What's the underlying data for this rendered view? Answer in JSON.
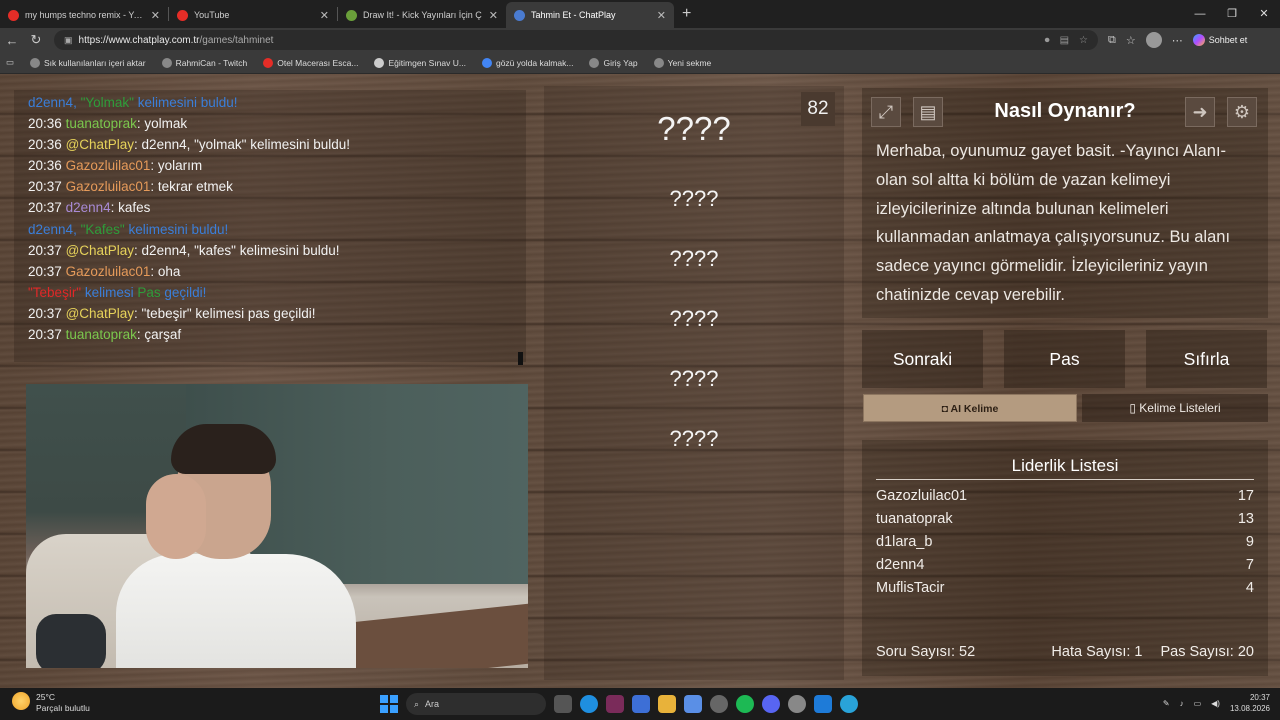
{
  "browser": {
    "tabs": [
      {
        "title": "my humps techno remix - YouTub",
        "favicon_color": "#e52d27",
        "active": false
      },
      {
        "title": "YouTube",
        "favicon_color": "#e52d27",
        "active": false
      },
      {
        "title": "Draw It! - Kick Yayınları İçin Ç",
        "favicon_color": "#6a9f3a",
        "active": false
      },
      {
        "title": "Tahmin Et - ChatPlay",
        "favicon_color": "#4a7bd0",
        "active": true
      }
    ],
    "url_host": "https://www.chatplay.com.tr",
    "url_path": "/games/tahminet",
    "copilot_label": "Sohbet et",
    "bookmarks": [
      {
        "label": "Sık kullanılanları içeri aktar",
        "icon_color": "#888888"
      },
      {
        "label": "RahmiCan - Twitch",
        "icon_color": "#888888"
      },
      {
        "label": "Otel Macerası Esca...",
        "icon_color": "#e52d27"
      },
      {
        "label": "Eğitimgen Sınav U...",
        "icon_color": "#cccccc"
      },
      {
        "label": "gözü yolda kalmak...",
        "icon_color": "#4285f4"
      },
      {
        "label": "Giriş Yap",
        "icon_color": "#888888"
      },
      {
        "label": "Yeni sekme",
        "icon_color": "#888888"
      }
    ]
  },
  "chat": {
    "lines": [
      {
        "type": "sys",
        "user": "d2enn4",
        "sep": ", ",
        "quoted": "\"Yolmak\"",
        "rest": " kelimesini buldu!"
      },
      {
        "type": "msg",
        "time": "20:36",
        "user": "tuanatoprak",
        "user_color": "#7bc74d",
        "text": ": yolmak"
      },
      {
        "type": "msg",
        "time": "20:36",
        "user": "@ChatPlay",
        "user_color": "#e6d25a",
        "text": ": d2enn4, \"yolmak\" kelimesini buldu!"
      },
      {
        "type": "msg",
        "time": "20:36",
        "user": "Gazozluilac01",
        "user_color": "#e59a5a",
        "text": ": yolarım"
      },
      {
        "type": "msg",
        "time": "20:37",
        "user": "Gazozluilac01",
        "user_color": "#e59a5a",
        "text": ": tekrar etmek"
      },
      {
        "type": "msg",
        "time": "20:37",
        "user": "d2enn4",
        "user_color": "#a98bd6",
        "text": ": kafes"
      },
      {
        "type": "sys",
        "user": "d2enn4",
        "sep": ", ",
        "quoted": "\"Kafes\"",
        "rest": " kelimesini buldu!"
      },
      {
        "type": "msg",
        "time": "20:37",
        "user": "@ChatPlay",
        "user_color": "#e6d25a",
        "text": ": d2enn4, \"kafes\" kelimesini buldu!"
      },
      {
        "type": "msg",
        "time": "20:37",
        "user": "Gazozluilac01",
        "user_color": "#e59a5a",
        "text": ": oha"
      },
      {
        "type": "skip",
        "word": "\"Tebeşir\"",
        "mid": " kelimesi ",
        "pas": "Pas",
        "end": " geçildi!"
      },
      {
        "type": "msg",
        "time": "20:37",
        "user": "@ChatPlay",
        "user_color": "#e6d25a",
        "text": ": \"tebeşir\" kelimesi pas geçildi!"
      },
      {
        "type": "msg",
        "time": "20:37",
        "user": "tuanatoprak",
        "user_color": "#7bc74d",
        "text": ": çarşaf"
      }
    ]
  },
  "game": {
    "timer": "82",
    "slots": [
      "????",
      "????",
      "????",
      "????",
      "????",
      "????"
    ]
  },
  "howto": {
    "title": "Nasıl Oynanır?",
    "text": "Merhaba, oyunumuz gayet basit. -Yayıncı Alanı- olan sol altta ki bölüm de yazan kelimeyi izleyicilerinize altında bulunan kelimeleri kullanmadan anlatmaya çalışıyorsunuz. Bu alanı sadece yayıncı görmelidir. İzleyicileriniz yayın chatinizde cevap verebilir."
  },
  "controls": {
    "next": "Sonraki",
    "pass": "Pas",
    "reset": "Sıfırla",
    "ai_word": "AI Kelime",
    "word_lists": "Kelime Listeleri"
  },
  "leaderboard": {
    "title": "Liderlik Listesi",
    "rows": [
      {
        "name": "Gazozluilac01",
        "score": "17"
      },
      {
        "name": "tuanatoprak",
        "score": "13"
      },
      {
        "name": "d1lara_b",
        "score": "9"
      },
      {
        "name": "d2enn4",
        "score": "7"
      },
      {
        "name": "MuflisTacir",
        "score": "4"
      }
    ],
    "questions": "Soru Sayısı: 52",
    "errors": "Hata Sayısı: 1",
    "passes": "Pas Sayısı: 20"
  },
  "taskbar": {
    "temp": "25°C",
    "weather": "Parçalı bulutlu",
    "search": "Ara",
    "time": "20:37",
    "date": "13.08.2026"
  }
}
